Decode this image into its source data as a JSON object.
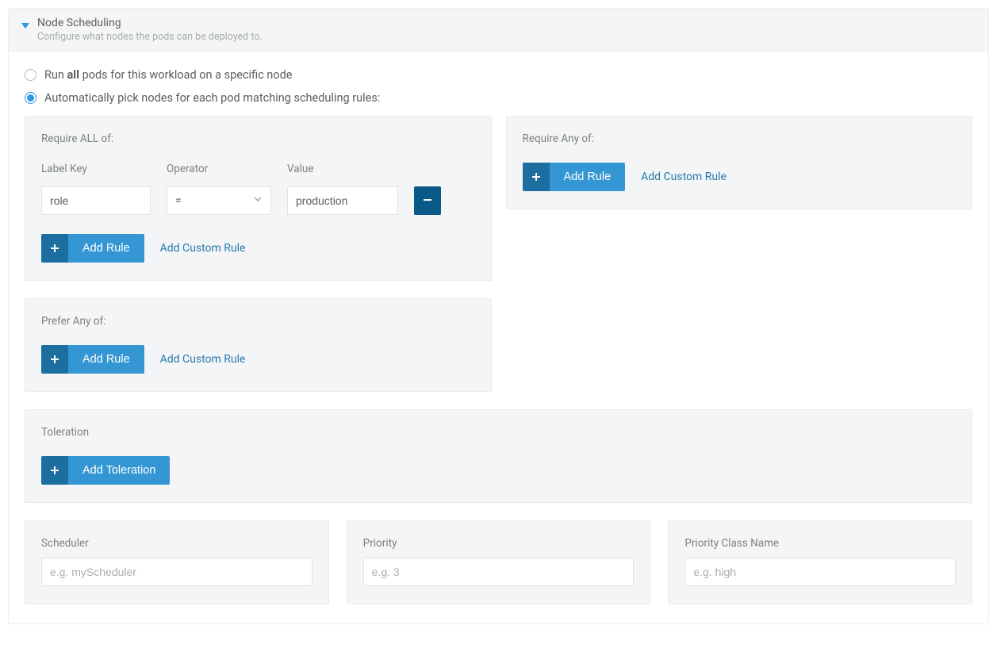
{
  "header": {
    "title": "Node Scheduling",
    "subtitle": "Configure what nodes the pods can be deployed to."
  },
  "radios": {
    "specific_prefix": "Run ",
    "specific_bold": "all",
    "specific_suffix": " pods for this workload on a specific node",
    "auto": "Automatically pick nodes for each pod matching scheduling rules:"
  },
  "require_all": {
    "title": "Require ALL of:",
    "labels": {
      "key": "Label Key",
      "operator": "Operator",
      "value": "Value"
    },
    "rule": {
      "key": "role",
      "operator": "=",
      "value": "production"
    },
    "add_rule": "Add Rule",
    "add_custom": "Add Custom Rule"
  },
  "require_any": {
    "title": "Require Any of:",
    "add_rule": "Add Rule",
    "add_custom": "Add Custom Rule"
  },
  "prefer_any": {
    "title": "Prefer Any of:",
    "add_rule": "Add Rule",
    "add_custom": "Add Custom Rule"
  },
  "toleration": {
    "title": "Toleration",
    "add": "Add Toleration"
  },
  "bottom": {
    "scheduler": {
      "label": "Scheduler",
      "placeholder": "e.g. myScheduler"
    },
    "priority": {
      "label": "Priority",
      "placeholder": "e.g. 3"
    },
    "priority_class": {
      "label": "Priority Class Name",
      "placeholder": "e.g. high"
    }
  }
}
